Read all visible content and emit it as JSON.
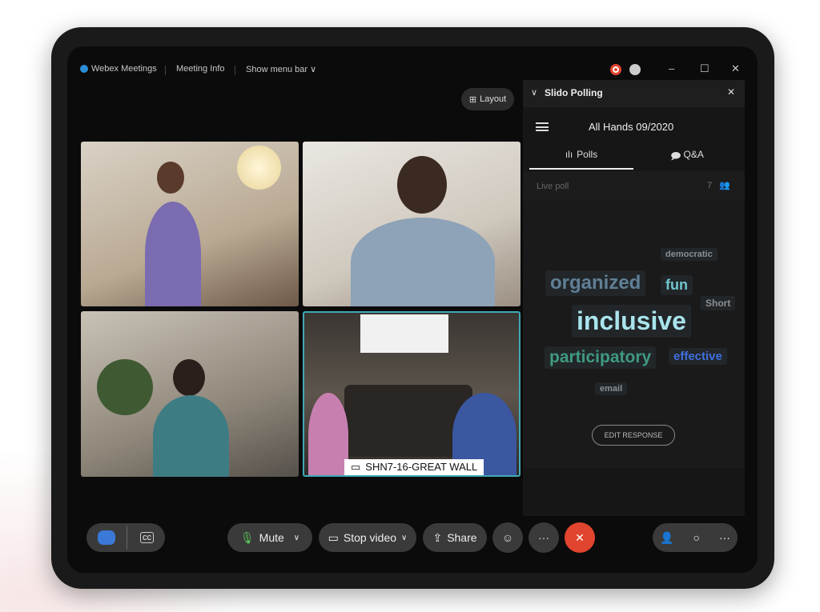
{
  "titlebar": {
    "app": "Webex Meetings",
    "meeting_info": "Meeting Info",
    "show_menu_bar": "Show menu bar",
    "chevron": "∨",
    "minimize": "–",
    "maximize": "☐",
    "close": "✕"
  },
  "layout_button": "Layout",
  "videos": [
    {
      "label": ""
    },
    {
      "label": ""
    },
    {
      "label": ""
    },
    {
      "label": "SHN7-16-GREAT WALL"
    }
  ],
  "slido": {
    "title": "Slido Polling",
    "event": "All Hands 09/2020",
    "tabs": [
      {
        "label": "Polls"
      },
      {
        "label": "Q&A"
      }
    ],
    "live_poll": "Live poll",
    "participants": "7",
    "words": [
      {
        "text": "democratic",
        "color": "#8a8f93"
      },
      {
        "text": "organized",
        "color": "#5f7f95"
      },
      {
        "text": "fun",
        "color": "#6fc7cf"
      },
      {
        "text": "Short",
        "color": "#8a8f93"
      },
      {
        "text": "inclusive",
        "color": "#a9e4ec"
      },
      {
        "text": "participatory",
        "color": "#3f9a80"
      },
      {
        "text": "effective",
        "color": "#3f6fe0"
      },
      {
        "text": "email",
        "color": "#8a8f93"
      }
    ],
    "edit_response": "EDIT RESPONSE"
  },
  "controls": {
    "mute": "Mute",
    "stop_video": "Stop video",
    "share": "Share",
    "more": "···",
    "end": "✕",
    "end_color": "#e2452f"
  }
}
